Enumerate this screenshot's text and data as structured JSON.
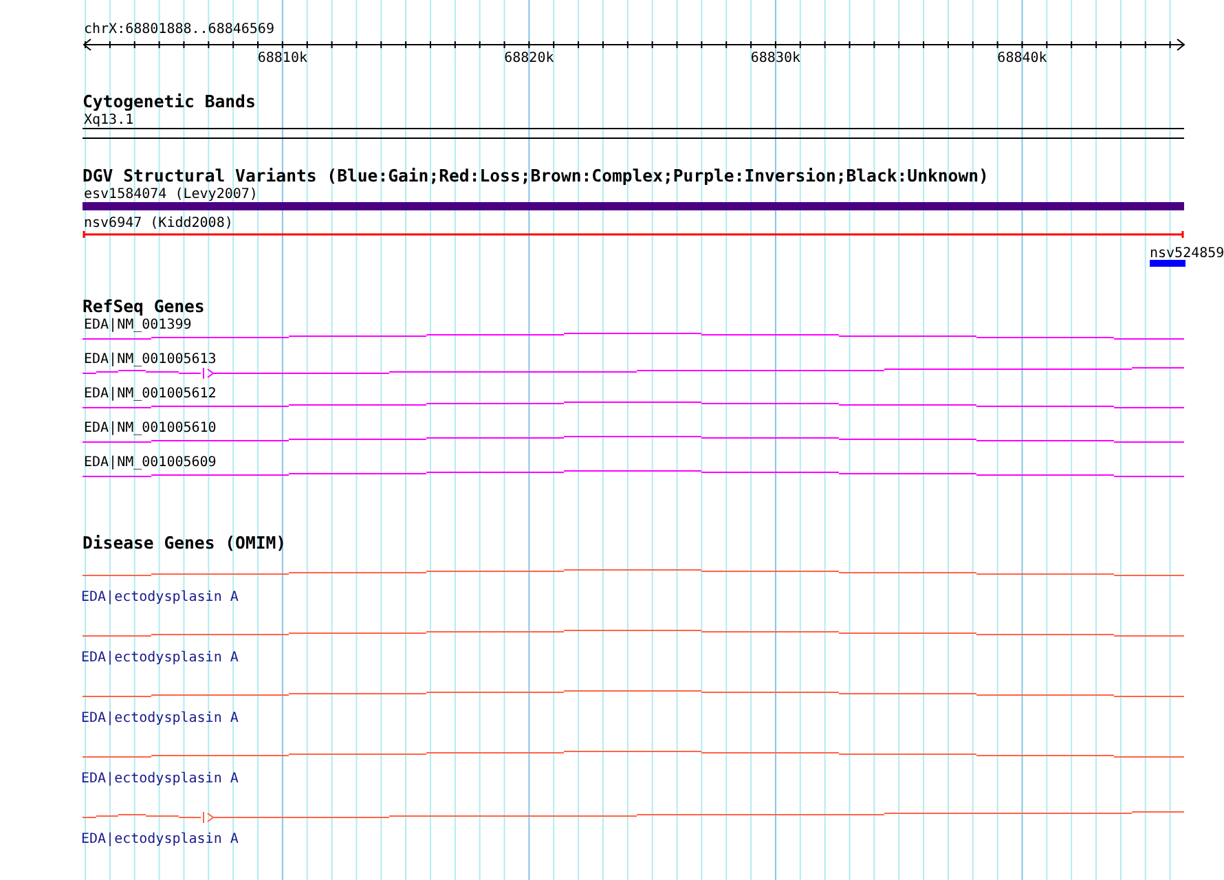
{
  "ruler": {
    "range_label": "chrX:68801888..68846569",
    "tick_labels": [
      "68810k",
      "68820k",
      "68830k",
      "68840k"
    ]
  },
  "cytogenetic_bands": {
    "title": "Cytogenetic Bands",
    "band_label": "Xq13.1"
  },
  "dgv_structural_variants": {
    "title": "DGV Structural Variants (Blue:Gain;Red:Loss;Brown:Complex;Purple:Inversion;Black:Unknown)",
    "features": [
      {
        "label": "esv1584074 (Levy2007)",
        "color": "#4b0082",
        "kind": "bar"
      },
      {
        "label": "nsv6947 (Kidd2008)",
        "color": "#ff0000",
        "kind": "line"
      },
      {
        "label": "nsv524859",
        "color": "#0000ff",
        "kind": "short-bar"
      }
    ]
  },
  "refseq_genes": {
    "title": "RefSeq Genes",
    "transcripts": [
      {
        "label": "EDA|NM_001399",
        "kind": "full"
      },
      {
        "label": "EDA|NM_001005613",
        "kind": "start-marked"
      },
      {
        "label": "EDA|NM_001005612",
        "kind": "full"
      },
      {
        "label": "EDA|NM_001005610",
        "kind": "full"
      },
      {
        "label": "EDA|NM_001005609",
        "kind": "full"
      }
    ]
  },
  "disease_genes": {
    "title": "Disease Genes (OMIM)",
    "genes": [
      {
        "label": "EDA|ectodysplasin A",
        "kind": "full"
      },
      {
        "label": "EDA|ectodysplasin A",
        "kind": "full"
      },
      {
        "label": "EDA|ectodysplasin A",
        "kind": "full"
      },
      {
        "label": "EDA|ectodysplasin A",
        "kind": "full"
      },
      {
        "label": "EDA|ectodysplasin A",
        "kind": "start-marked"
      }
    ]
  }
}
